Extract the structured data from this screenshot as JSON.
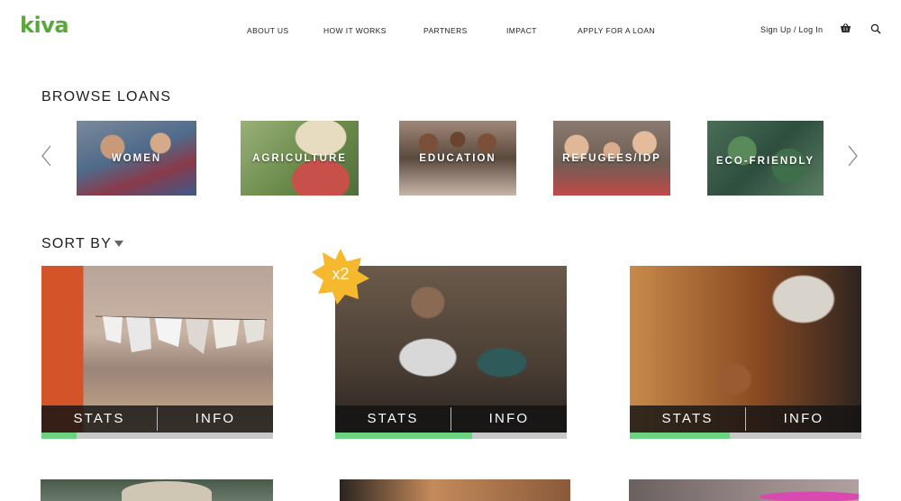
{
  "header": {
    "logo": "kiva",
    "nav": [
      "ABOUT US",
      "HOW IT WORKS",
      "PARTNERS",
      "IMPACT",
      "APPLY FOR A LOAN"
    ],
    "signup": "Sign Up / Log In",
    "icons": [
      "cart-icon",
      "search-icon"
    ]
  },
  "browse": {
    "title": "BROWSE LOANS",
    "categories": [
      "WOMEN",
      "AGRICULTURE",
      "EDUCATION",
      "REFUGEES/IDP",
      "ECO-FRIENDLY"
    ],
    "icons": [
      "chevron-left-icon",
      "chevron-right-icon"
    ]
  },
  "sort": {
    "title": "SORT BY",
    "icon": "caret-down-icon"
  },
  "loans": [
    {
      "stats_label": "STATS",
      "info_label": "INFO",
      "progress": 0.15
    },
    {
      "stats_label": "STATS",
      "info_label": "INFO",
      "progress": 0.59,
      "badge": "x2"
    },
    {
      "stats_label": "STATS",
      "info_label": "INFO",
      "progress": 0.43
    }
  ],
  "colors": {
    "brand": "#5aa83a",
    "progress": "#6bd27f",
    "progress_track": "#c8c8c8",
    "badge": "#f5b82e"
  }
}
